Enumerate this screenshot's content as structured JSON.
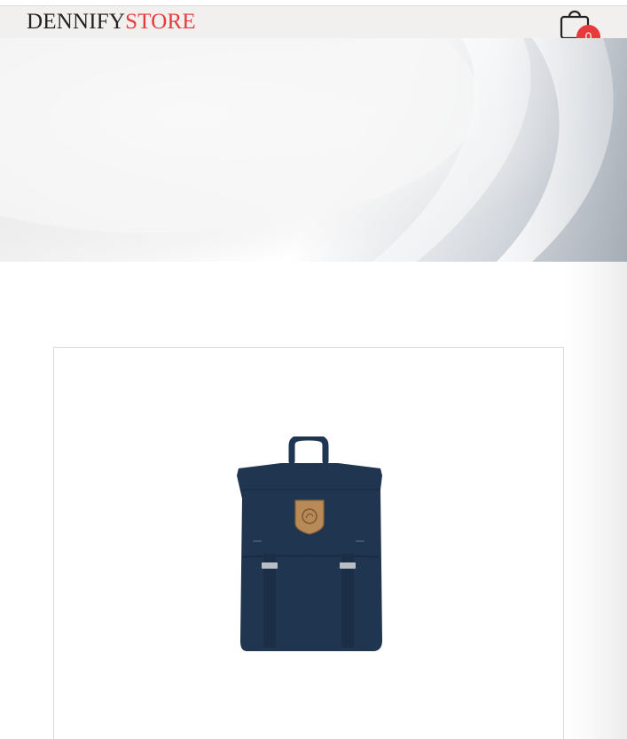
{
  "header": {
    "logo": {
      "part1": "DENNIFY",
      "part2": "STORE"
    },
    "cart": {
      "icon": "shopping-bag-icon",
      "count": "0"
    }
  },
  "hero": {
    "image": "abstract-silver-curves-banner"
  },
  "product": {
    "image": "navy-backpack-with-leather-badge"
  },
  "colors": {
    "accent": "#e8393d",
    "header_bg": "#f1f0ef",
    "logo_text": "#222222",
    "backpack": "#1f3550"
  }
}
